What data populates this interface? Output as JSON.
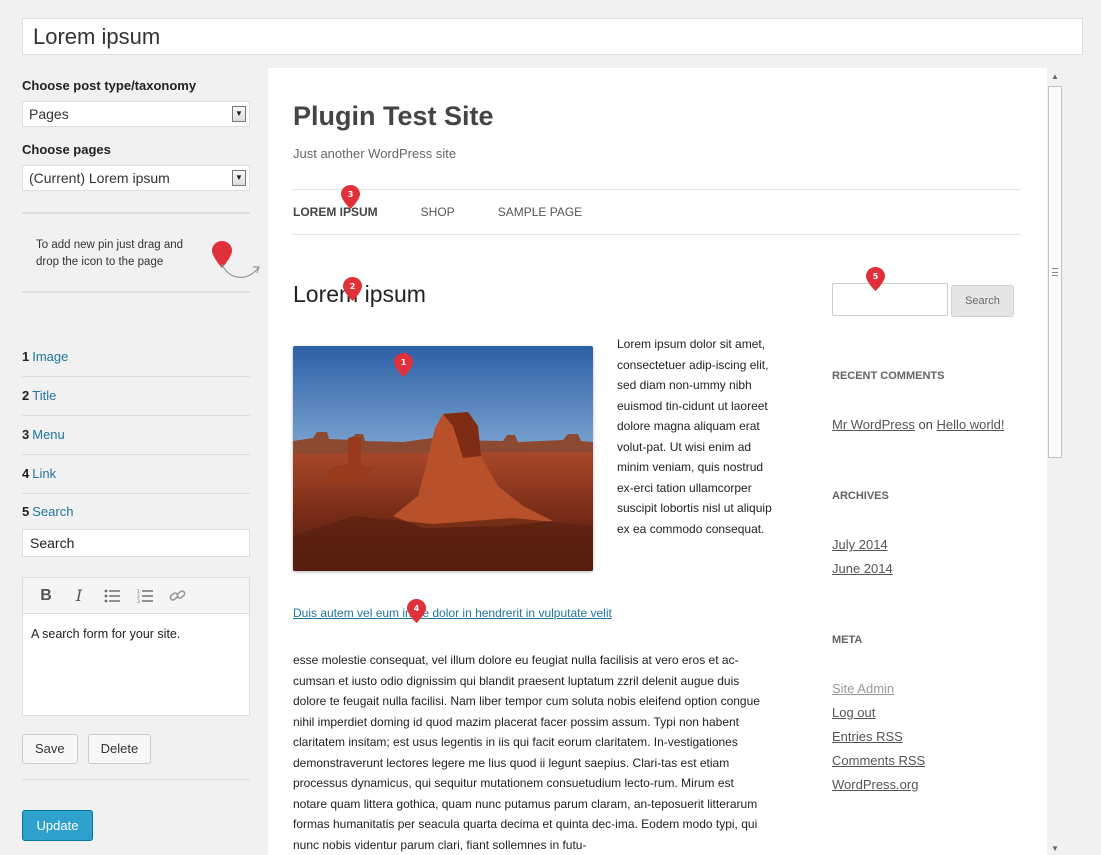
{
  "title_field": {
    "value": "Lorem ipsum"
  },
  "sidebar": {
    "post_type_label": "Choose post type/taxonomy",
    "post_type_value": "Pages",
    "pages_label": "Choose pages",
    "pages_value": "(Current) Lorem ipsum",
    "drag_hint": "To add new pin just drag and drop the icon to the page",
    "pin_items": [
      {
        "num": "1",
        "name": "Image"
      },
      {
        "num": "2",
        "name": "Title"
      },
      {
        "num": "3",
        "name": "Menu"
      },
      {
        "num": "4",
        "name": "Link"
      },
      {
        "num": "5",
        "name": "Search"
      }
    ],
    "pin_name_value": "Search",
    "editor_text": "A search form for your site.",
    "save_label": "Save",
    "delete_label": "Delete",
    "update_label": "Update",
    "accent_color": "#2ea2cc"
  },
  "preview": {
    "site_title": "Plugin Test Site",
    "site_description": "Just another WordPress site",
    "nav": [
      "LOREM IPSUM",
      "SHOP",
      "SAMPLE PAGE"
    ],
    "page_title": "Lorem ipsum",
    "side_paragraph": "Lorem ipsum dolor sit amet, consectetuer adip-iscing elit, sed diam non-ummy nibh euismod tin-cidunt ut laoreet dolore magna aliquam erat volut-pat. Ut wisi enim ad minim veniam, quis nostrud ex-erci tation ullamcorper suscipit lobortis nisl ut aliquip ex ea commodo consequat.",
    "link_text": "Duis autem vel eum iriure dolor in hendrerit in vulputate velit",
    "body_paragraph": "esse molestie consequat, vel illum dolore eu feugiat nulla facilisis at vero eros et ac-cumsan et iusto odio dignissim qui blandit praesent luptatum zzril delenit augue duis dolore te feugait nulla facilisi. Nam liber tempor cum soluta nobis eleifend option congue nihil imperdiet doming id quod mazim placerat facer possim assum. Typi non habent claritatem insitam; est usus legentis in iis qui facit eorum claritatem. In-vestigationes demonstraverunt lectores legere me lius quod ii legunt saepius. Clari-tas est etiam processus dynamicus, qui sequitur mutationem consuetudium lecto-rum. Mirum est notare quam littera gothica, quam nunc putamus parum claram, an-teposuerit litterarum formas humanitatis per seacula quarta decima et quinta dec-ima. Eodem modo typi, qui nunc nobis videntur parum clari, fiant sollemnes in futu-",
    "search_button": "Search",
    "widgets": {
      "recent_comments_heading": "RECENT COMMENTS",
      "comment_author": "Mr WordPress",
      "comment_on": "on",
      "comment_post": "Hello world!",
      "archives_heading": "ARCHIVES",
      "archives": [
        "July 2014",
        "June 2014"
      ],
      "meta_heading": "META",
      "meta_links": [
        "Site Admin",
        "Log out",
        "Entries RSS",
        "Comments RSS",
        "WordPress.org"
      ]
    },
    "pins": [
      "1",
      "2",
      "3",
      "4",
      "5"
    ],
    "pin_color": "#e0303a"
  }
}
